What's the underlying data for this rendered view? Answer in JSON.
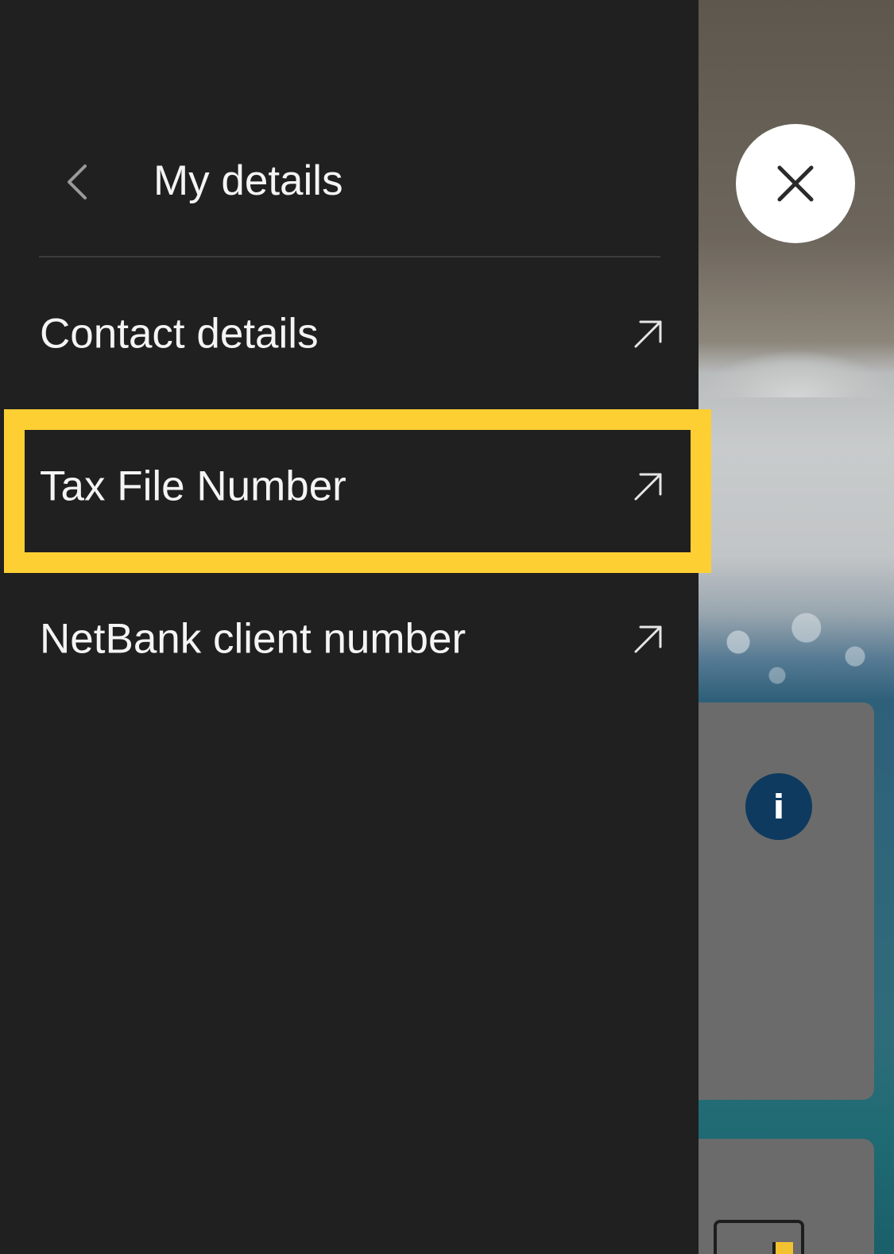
{
  "header": {
    "title": "My details",
    "back_icon": "chevron-left-icon",
    "close_icon": "close-icon"
  },
  "menu": {
    "items": [
      {
        "label": "Contact details",
        "icon": "external-arrow-icon"
      },
      {
        "label": "Tax File Number",
        "icon": "external-arrow-icon",
        "highlighted": true
      },
      {
        "label": "NetBank client number",
        "icon": "external-arrow-icon"
      }
    ]
  },
  "background": {
    "info_symbol": "i"
  },
  "colors": {
    "drawer_background": "#202021",
    "text": "#f4f4f4",
    "highlight": "#fecf33",
    "info_badge": "#0e3a5f"
  }
}
